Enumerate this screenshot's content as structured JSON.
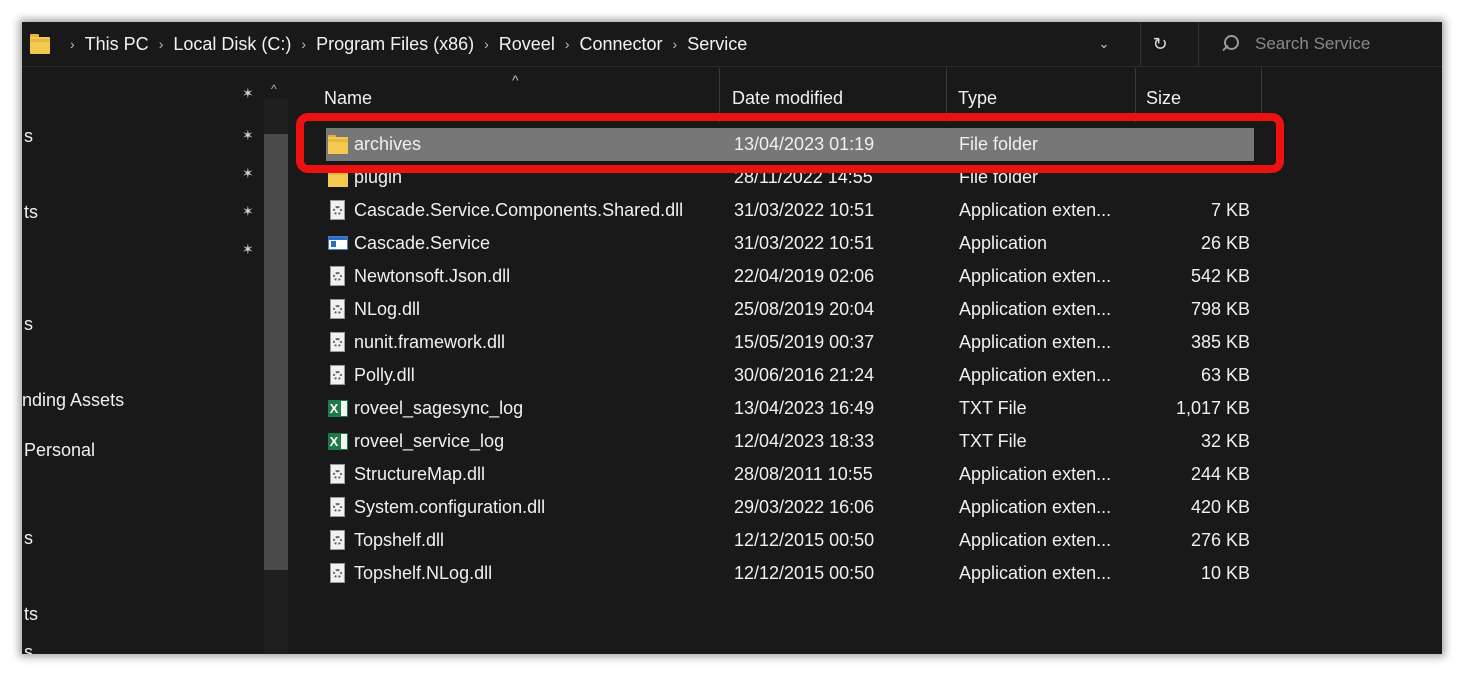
{
  "address_bar": {
    "crumbs": [
      "This PC",
      "Local Disk (C:)",
      "Program Files (x86)",
      "Roveel",
      "Connector",
      "Service"
    ],
    "search_placeholder": "Search Service"
  },
  "nav": {
    "items": [
      "s",
      "ts",
      "s",
      "nding Assets",
      "Personal",
      "s",
      "ts",
      "s"
    ]
  },
  "columns": {
    "name": "Name",
    "date": "Date modified",
    "type": "Type",
    "size": "Size"
  },
  "files": [
    {
      "name": "archives",
      "date": "13/04/2023 01:19",
      "type": "File folder",
      "size": "",
      "icon": "folder-icon",
      "selected": true
    },
    {
      "name": "plugin",
      "date": "28/11/2022 14:55",
      "type": "File folder",
      "size": "",
      "icon": "folder-icon"
    },
    {
      "name": "Cascade.Service.Components.Shared.dll",
      "date": "31/03/2022 10:51",
      "type": "Application exten...",
      "size": "7 KB",
      "icon": "dll-icon"
    },
    {
      "name": "Cascade.Service",
      "date": "31/03/2022 10:51",
      "type": "Application",
      "size": "26 KB",
      "icon": "application-icon"
    },
    {
      "name": "Newtonsoft.Json.dll",
      "date": "22/04/2019 02:06",
      "type": "Application exten...",
      "size": "542 KB",
      "icon": "dll-icon"
    },
    {
      "name": "NLog.dll",
      "date": "25/08/2019 20:04",
      "type": "Application exten...",
      "size": "798 KB",
      "icon": "dll-icon"
    },
    {
      "name": "nunit.framework.dll",
      "date": "15/05/2019 00:37",
      "type": "Application exten...",
      "size": "385 KB",
      "icon": "dll-icon"
    },
    {
      "name": "Polly.dll",
      "date": "30/06/2016 21:24",
      "type": "Application exten...",
      "size": "63 KB",
      "icon": "dll-icon"
    },
    {
      "name": "roveel_sagesync_log",
      "date": "13/04/2023 16:49",
      "type": "TXT File",
      "size": "1,017 KB",
      "icon": "excel-text-icon"
    },
    {
      "name": "roveel_service_log",
      "date": "12/04/2023 18:33",
      "type": "TXT File",
      "size": "32 KB",
      "icon": "excel-text-icon"
    },
    {
      "name": "StructureMap.dll",
      "date": "28/08/2011 10:55",
      "type": "Application exten...",
      "size": "244 KB",
      "icon": "dll-icon"
    },
    {
      "name": "System.configuration.dll",
      "date": "29/03/2022 16:06",
      "type": "Application exten...",
      "size": "420 KB",
      "icon": "dll-icon"
    },
    {
      "name": "Topshelf.dll",
      "date": "12/12/2015 00:50",
      "type": "Application exten...",
      "size": "276 KB",
      "icon": "dll-icon"
    },
    {
      "name": "Topshelf.NLog.dll",
      "date": "12/12/2015 00:50",
      "type": "Application exten...",
      "size": "10 KB",
      "icon": "dll-icon"
    }
  ],
  "colors": {
    "background": "#191919",
    "selected_row": "#777777",
    "highlight_outline": "#ee1111",
    "folder": "#f3c94f"
  }
}
